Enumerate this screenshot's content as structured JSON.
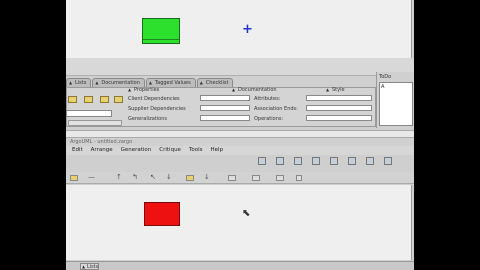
{
  "tabs_top": [
    {
      "label": "Lists"
    },
    {
      "label": "Documentation"
    },
    {
      "label": "Tagged Values"
    },
    {
      "label": "Checklist"
    }
  ],
  "properties_panel": {
    "subtabs": [
      "Properties",
      "Documentation",
      "Style"
    ],
    "rows": [
      {
        "label": "Client Dependencies"
      },
      {
        "label": "Supplier Dependencies"
      },
      {
        "label": "Generalizations"
      }
    ],
    "rows_right": [
      {
        "label": "Attributes:"
      },
      {
        "label": "Association Ends:"
      },
      {
        "label": "Operations:"
      }
    ]
  },
  "side_panel": {
    "tab_label": "ToDo",
    "item": "A"
  },
  "window2_title": "ArgoUML - untitled.zargo",
  "menubar": {
    "items": [
      "Edit",
      "Arrange",
      "Generation",
      "Critique",
      "Tools",
      "Help"
    ]
  },
  "status_tab_label": "Lists",
  "colors": {
    "class_selected": "#2ee02e",
    "class_new": "#ee1111",
    "canvas": "#efefef"
  },
  "icons": [
    "plus-cursor-icon",
    "arrow-pointer-icon"
  ]
}
